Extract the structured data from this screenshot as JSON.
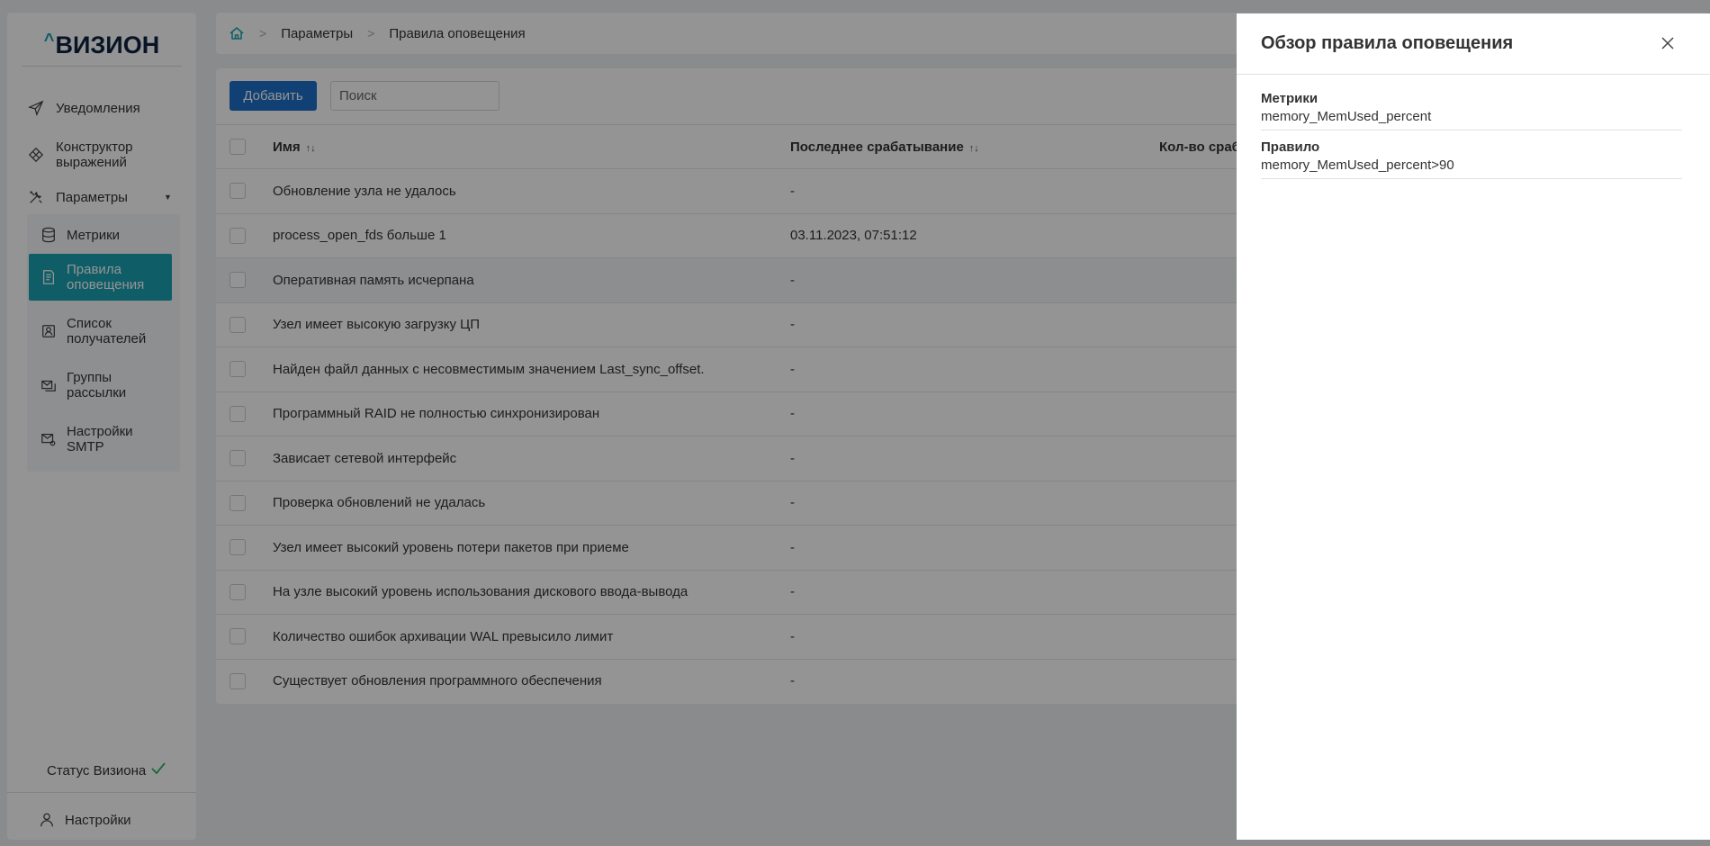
{
  "sidebar": {
    "logo": "ВИЗИОН",
    "logo_mark": "^",
    "items": [
      {
        "label": "Уведомления",
        "icon": "send-icon"
      },
      {
        "label": "Конструктор выражений",
        "icon": "diamond-icon"
      },
      {
        "label": "Параметры",
        "icon": "tools-icon",
        "expanded": true
      }
    ],
    "sub_items": [
      {
        "label": "Метрики",
        "icon": "database-icon",
        "active": false
      },
      {
        "label": "Правила оповещения",
        "icon": "document-icon",
        "active": true
      },
      {
        "label": "Список получателей",
        "icon": "contact-list-icon",
        "active": false
      },
      {
        "label": "Группы рассылки",
        "icon": "mail-group-icon",
        "active": false
      },
      {
        "label": "Настройки SMTP",
        "icon": "mail-settings-icon",
        "active": false
      }
    ],
    "status_label": "Статус Визиона",
    "settings_label": "Настройки"
  },
  "breadcrumb": {
    "items": [
      "Параметры",
      "Правила оповещения"
    ]
  },
  "toolbar": {
    "add_label": "Добавить",
    "search_placeholder": "Поиск"
  },
  "table": {
    "columns": {
      "name": "Имя",
      "last_triggered": "Последнее срабатывание",
      "count": "Кол-во сраб"
    },
    "rows": [
      {
        "name": "Обновление узла не удалось",
        "last": "-"
      },
      {
        "name": "process_open_fds больше 1",
        "last": "03.11.2023, 07:51:12"
      },
      {
        "name": "Оперативная память исчерпана",
        "last": "-"
      },
      {
        "name": "Узел имеет высокую загрузку ЦП",
        "last": "-"
      },
      {
        "name": "Найден файл данных с несовместимым значением Last_sync_offset.",
        "last": "-"
      },
      {
        "name": "Программный RAID не полностью синхронизирован",
        "last": "-"
      },
      {
        "name": "Зависает сетевой интерфейс",
        "last": "-"
      },
      {
        "name": "Проверка обновлений не удалась",
        "last": "-"
      },
      {
        "name": "Узел имеет высокий уровень потери пакетов при приеме",
        "last": "-"
      },
      {
        "name": "На узле высокий уровень использования дискового ввода-вывода",
        "last": "-"
      },
      {
        "name": "Количество ошибок архивации WAL превысило лимит",
        "last": "-"
      },
      {
        "name": "Существует обновления программного обеспечения",
        "last": "-"
      }
    ]
  },
  "panel": {
    "title": "Обзор правила оповещения",
    "fields": [
      {
        "label": "Метрики",
        "value": "memory_MemUsed_percent"
      },
      {
        "label": "Правило",
        "value": "memory_MemUsed_percent>90"
      }
    ]
  },
  "colors": {
    "accent": "#1aa1b1",
    "primary_button": "#1e6fc9",
    "status_ok": "#2bb36b"
  }
}
